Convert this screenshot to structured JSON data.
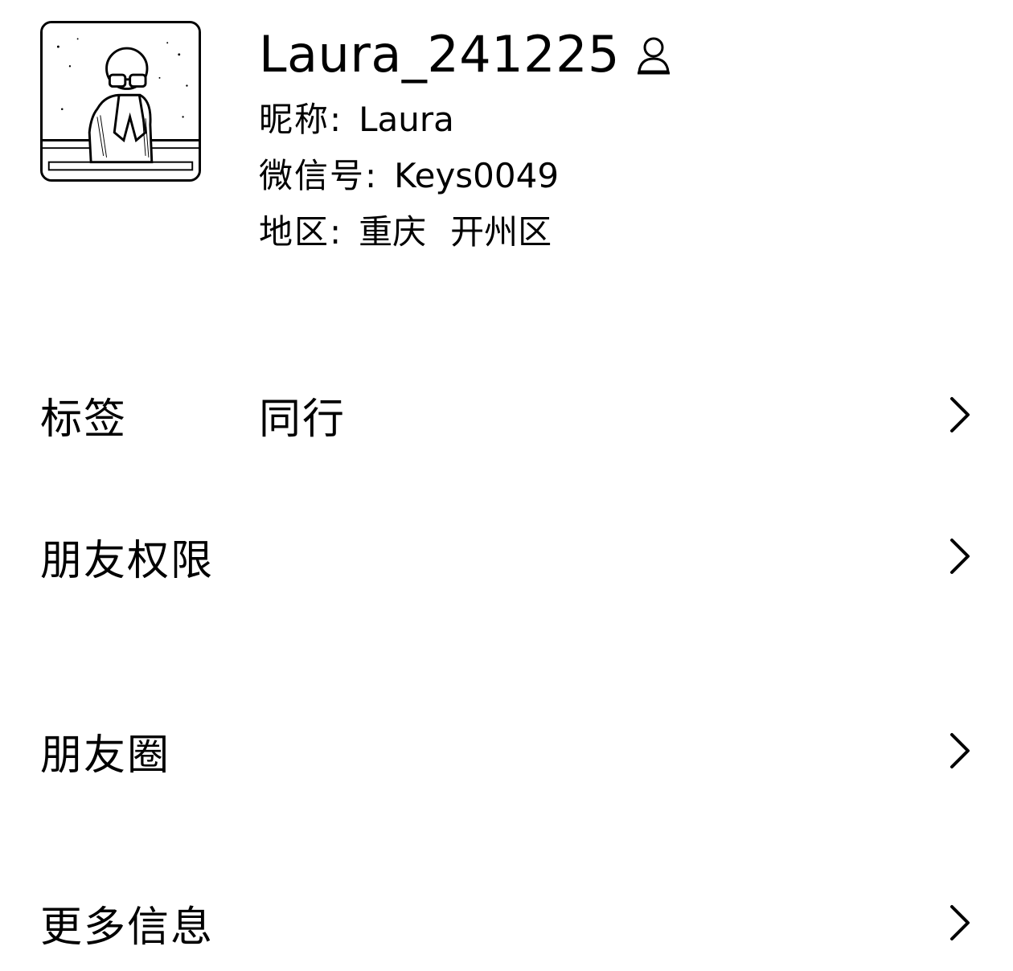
{
  "profile": {
    "display_name": "Laura_241225",
    "gender_icon": "person-icon",
    "nickname_label": "昵称:",
    "nickname_value": "Laura",
    "wechat_id_label": "微信号:",
    "wechat_id_value": "Keys0049",
    "region_label": "地区:",
    "region_province": "重庆",
    "region_district": "开州区"
  },
  "rows": [
    {
      "label": "标签",
      "value": "同行",
      "icon": "chevron-right-icon"
    },
    {
      "label": "朋友权限",
      "value": "",
      "icon": "chevron-right-icon"
    },
    {
      "label": "朋友圈",
      "value": "",
      "icon": "chevron-right-icon"
    },
    {
      "label": "更多信息",
      "value": "",
      "icon": "chevron-right-icon"
    }
  ],
  "colors": {
    "text": "#000000",
    "background": "#ffffff"
  }
}
